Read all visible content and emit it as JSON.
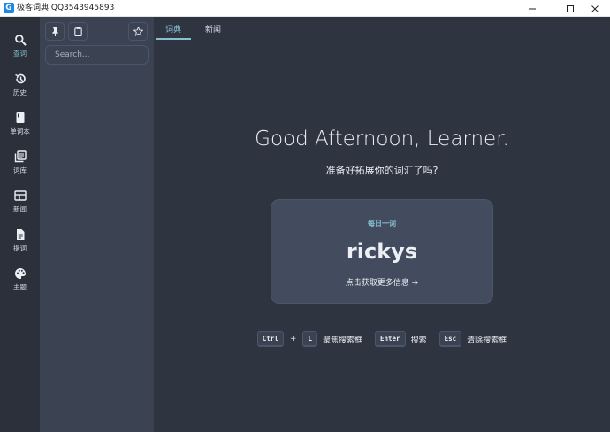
{
  "window": {
    "logo": "G",
    "title": "极客词典 QQ3543945893",
    "controls": [
      "minimize-icon",
      "maximize-icon",
      "close-icon"
    ]
  },
  "nav": {
    "items": [
      {
        "id": "lookup",
        "label": "查词",
        "icon": "search-icon",
        "active": true
      },
      {
        "id": "history",
        "label": "历史",
        "icon": "history-icon",
        "active": false
      },
      {
        "id": "wordbook",
        "label": "单词本",
        "icon": "book-icon",
        "active": false
      },
      {
        "id": "library",
        "label": "词库",
        "icon": "library-icon",
        "active": false
      },
      {
        "id": "news",
        "label": "新闻",
        "icon": "newspaper-icon",
        "active": false
      },
      {
        "id": "extract",
        "label": "提词",
        "icon": "document-icon",
        "active": false
      },
      {
        "id": "theme",
        "label": "主题",
        "icon": "palette-icon",
        "active": false
      }
    ]
  },
  "sidepanel": {
    "tools": [
      "pin-icon",
      "clipboard-icon",
      "star-icon"
    ],
    "search_placeholder": "Search..."
  },
  "tabs": [
    {
      "label": "词典",
      "active": true
    },
    {
      "label": "新闻",
      "active": false
    }
  ],
  "home": {
    "greeting": "Good Afternoon, Learner.",
    "subtitle": "准备好拓展你的词汇了吗?",
    "word_of_day": {
      "label": "每日一词",
      "word": "rickys",
      "link": "点击获取更多信息 ➔"
    },
    "shortcuts": {
      "ctrl": "Ctrl",
      "plus": "+",
      "l": "L",
      "focus_text": "聚焦搜索框",
      "enter": "Enter",
      "search_text": "搜索",
      "esc": "Esc",
      "clear_text": "清除搜索框"
    }
  },
  "colors": {
    "background": "#2e3440",
    "nav_background": "#2b303b",
    "panel_background": "#3b4252",
    "card_background": "#434c5e",
    "accent": "#88c0d0",
    "text": "#eceff4"
  }
}
